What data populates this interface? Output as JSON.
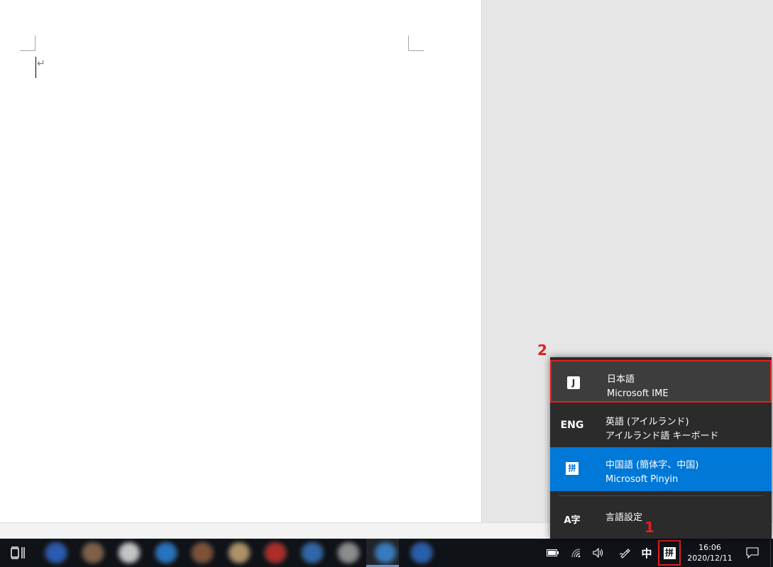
{
  "document": {
    "paragraph_mark": "↵"
  },
  "taskbar": {
    "apps": [
      {
        "color": "#2c63c4"
      },
      {
        "color": "#8a6a4c"
      },
      {
        "color": "#d8d8d8"
      },
      {
        "color": "#2a7fd3"
      },
      {
        "color": "#8a5a3a"
      },
      {
        "color": "#c0a070"
      },
      {
        "color": "#c0302a"
      },
      {
        "color": "#3470b8"
      },
      {
        "color": "#9a9a9a"
      },
      {
        "color": "#3a86d0"
      },
      {
        "color": "#2a68c0"
      }
    ],
    "tray": {
      "ime_mode": "中",
      "ime_glyph": "拼",
      "time": "16:06",
      "date": "2020/12/11"
    }
  },
  "flyout": {
    "items": [
      {
        "icon_text": "J",
        "line1": "日本語",
        "line2": "Microsoft IME"
      },
      {
        "icon_text": "ENG",
        "line1": "英語 (アイルランド)",
        "line2": "アイルランド語 キーボード"
      },
      {
        "icon_text": "拼",
        "line1": "中国語 (簡体字、中国)",
        "line2": "Microsoft Pinyin"
      }
    ],
    "settings": {
      "icon_text": "A字",
      "label": "言語設定"
    }
  },
  "annotations": {
    "step1": "1",
    "step2": "2"
  },
  "colors": {
    "accent": "#0078d7",
    "highlight_border": "#e02020",
    "flyout_bg": "#2b2b2b",
    "taskbar_bg": "#0f1217"
  }
}
